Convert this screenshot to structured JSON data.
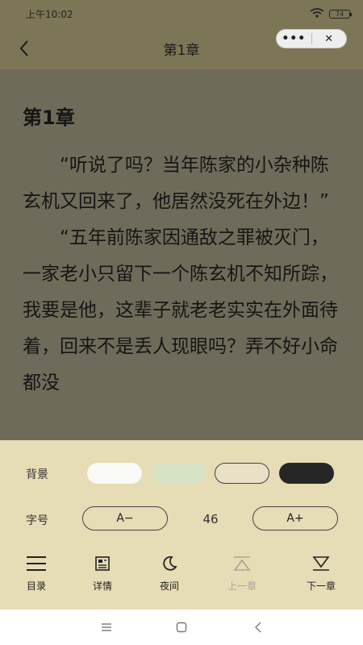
{
  "status": {
    "time": "上午10:02",
    "battery": "74"
  },
  "nav": {
    "title": "第1章",
    "more": "•••",
    "close": "✕"
  },
  "reader": {
    "chapter_title": "第1章",
    "paragraphs": [
      "“听说了吗？当年陈家的小杂种陈玄机又回来了，他居然没死在外边！”",
      "“五年前陈家因通敌之罪被灭门，一家老小只留下一个陈玄机不知所踪，我要是他，这辈子就老老实实在外面待着，回来不是丢人现眼吗？弄不好小命都没"
    ]
  },
  "settings": {
    "background_label": "背景",
    "backgrounds": [
      {
        "name": "white",
        "color": "#f9f9f7"
      },
      {
        "name": "green",
        "color": "#d5e2c4"
      },
      {
        "name": "beige",
        "color": "#e9e1c5"
      },
      {
        "name": "dark",
        "color": "#262626"
      }
    ],
    "font_label": "字号",
    "font_decrease": "A−",
    "font_size": "46",
    "font_increase": "A+"
  },
  "toolbar": {
    "items": [
      {
        "label": "目录",
        "icon": "menu-icon",
        "enabled": true
      },
      {
        "label": "详情",
        "icon": "details-icon",
        "enabled": true
      },
      {
        "label": "夜间",
        "icon": "moon-icon",
        "enabled": true
      },
      {
        "label": "上一章",
        "icon": "prev-chapter-icon",
        "enabled": false
      },
      {
        "label": "下一章",
        "icon": "next-chapter-icon",
        "enabled": true
      }
    ]
  },
  "colors": {
    "panel_bg": "#e6dcb6",
    "overlay_text_bg": "#6f6b5a",
    "nav_bg": "#7c7657"
  }
}
